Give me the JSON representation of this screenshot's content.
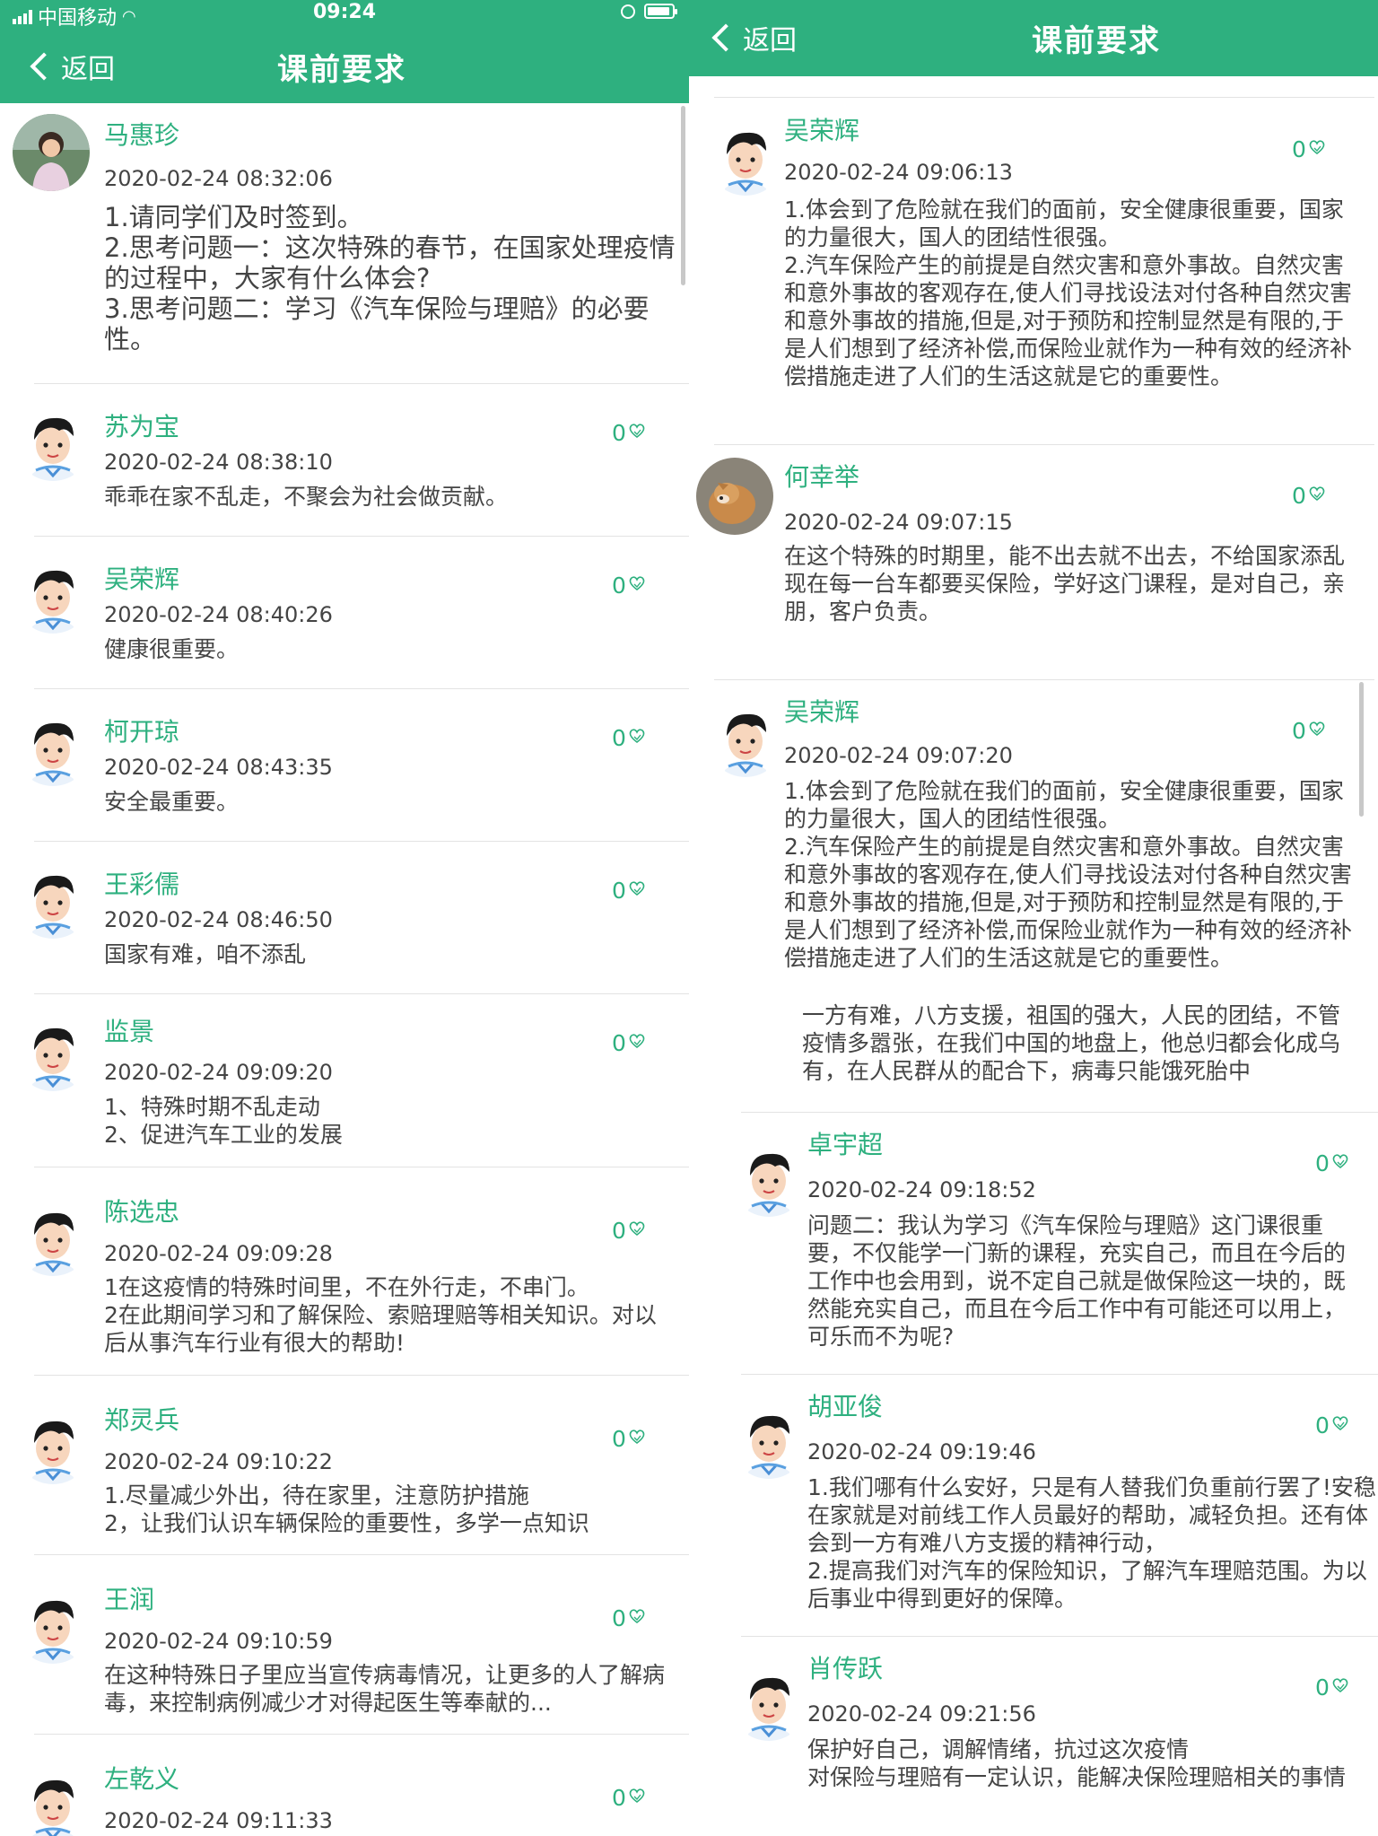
{
  "left": {
    "status": {
      "carrier": "中国移动",
      "time": "09:24"
    },
    "nav": {
      "back": "返回",
      "title": "课前要求"
    },
    "posts": [
      {
        "name": "马惠珍",
        "date": "2020-02-24 08:32:06",
        "body": "1.请同学们及时签到。\n2.思考问题一：这次特殊的春节，在国家处理疫情的过程中，大家有什么体会?\n3.思考问题二：学习《汽车保险与理赔》的必要性。",
        "likes": ""
      },
      {
        "name": "苏为宝",
        "date": "2020-02-24 08:38:10",
        "body": "乖乖在家不乱走，不聚会为社会做贡献。",
        "likes": "0"
      },
      {
        "name": "吴荣辉",
        "date": "2020-02-24 08:40:26",
        "body": "健康很重要。",
        "likes": "0"
      },
      {
        "name": "柯开琼",
        "date": "2020-02-24 08:43:35",
        "body": "安全最重要。",
        "likes": "0"
      },
      {
        "name": "王彩儒",
        "date": "2020-02-24 08:46:50",
        "body": "国家有难，咱不添乱",
        "likes": "0"
      },
      {
        "name": "监景",
        "date": "2020-02-24 09:09:20",
        "body": "1、特殊时期不乱走动\n2、促进汽车工业的发展",
        "likes": "0"
      },
      {
        "name": "陈选忠",
        "date": "2020-02-24 09:09:28",
        "body": "1在这疫情的特殊时间里，不在外行走，不串门。\n2在此期间学习和了解保险、索赔理赔等相关知识。对以后从事汽车行业有很大的帮助!",
        "likes": "0"
      },
      {
        "name": "郑灵兵",
        "date": "2020-02-24 09:10:22",
        "body": "1.尽量减少外出，待在家里，注意防护措施\n2，让我们认识车辆保险的重要性，多学一点知识",
        "likes": "0"
      },
      {
        "name": "王润",
        "date": "2020-02-24 09:10:59",
        "body": "在这种特殊日子里应当宣传病毒情况，让更多的人了解病毒，来控制病例减少才对得起医生等奉献的...",
        "likes": "0"
      },
      {
        "name": "左乾义",
        "date": "2020-02-24 09:11:33",
        "body": "",
        "likes": "0"
      }
    ]
  },
  "right": {
    "nav": {
      "back": "返回",
      "title": "课前要求"
    },
    "posts": [
      {
        "name": "吴荣辉",
        "date": "2020-02-24 09:06:13",
        "body": "1.体会到了危险就在我们的面前，安全健康很重要，国家的力量很大，国人的团结性很强。\n2.汽车保险产生的前提是自然灾害和意外事故。自然灾害和意外事故的客观存在,使人们寻找设法对付各种自然灾害和意外事故的措施,但是,对于预防和控制显然是有限的,于是人们想到了经济补偿,而保险业就作为一种有效的经济补偿措施走进了人们的生活这就是它的重要性。",
        "likes": "0"
      },
      {
        "name": "何幸举",
        "date": "2020-02-24 09:07:15",
        "body": "在这个特殊的时期里，能不出去就不出去，不给国家添乱\n现在每一台车都要买保险，学好这门课程，是对自己，亲朋，客户负责。",
        "likes": "0"
      },
      {
        "name": "吴荣辉",
        "date": "2020-02-24 09:07:20",
        "body": "1.体会到了危险就在我们的面前，安全健康很重要，国家的力量很大，国人的团结性很强。\n2.汽车保险产生的前提是自然灾害和意外事故。自然灾害和意外事故的客观存在,使人们寻找设法对付各种自然灾害和意外事故的措施,但是,对于预防和控制显然是有限的,于是人们想到了经济补偿,而保险业就作为一种有效的经济补偿措施走进了人们的生活这就是它的重要性。",
        "extra": "一方有难，八方支援，祖国的强大，人民的团结，不管疫情多嚣张，在我们中国的地盘上，他总归都会化成乌有，在人民群从的配合下，病毒只能饿死胎中",
        "likes": "0"
      },
      {
        "name": "卓宇超",
        "date": "2020-02-24 09:18:52",
        "body": "问题二：我认为学习《汽车保险与理赔》这门课很重要，不仅能学一门新的课程，充实自己，而且在今后的工作中也会用到，说不定自己就是做保险这一块的，既然能充实自己，而且在今后工作中有可能还可以用上，可乐而不为呢?",
        "likes": "0"
      },
      {
        "name": "胡亚俊",
        "date": "2020-02-24 09:19:46",
        "body": "1.我们哪有什么安好，只是有人替我们负重前行罢了!安稳在家就是对前线工作人员最好的帮助，减轻负担。还有体会到一方有难八方支援的精神行动，\n2.提高我们对汽车的保险知识，了解汽车理赔范围。为以后事业中得到更好的保障。",
        "likes": "0"
      },
      {
        "name": "肖传跃",
        "date": "2020-02-24 09:21:56",
        "body": "保护好自己，调解情绪，抗过这次疫情\n对保险与理赔有一定认识，能解决保险理赔相关的事情",
        "likes": "0"
      }
    ]
  }
}
